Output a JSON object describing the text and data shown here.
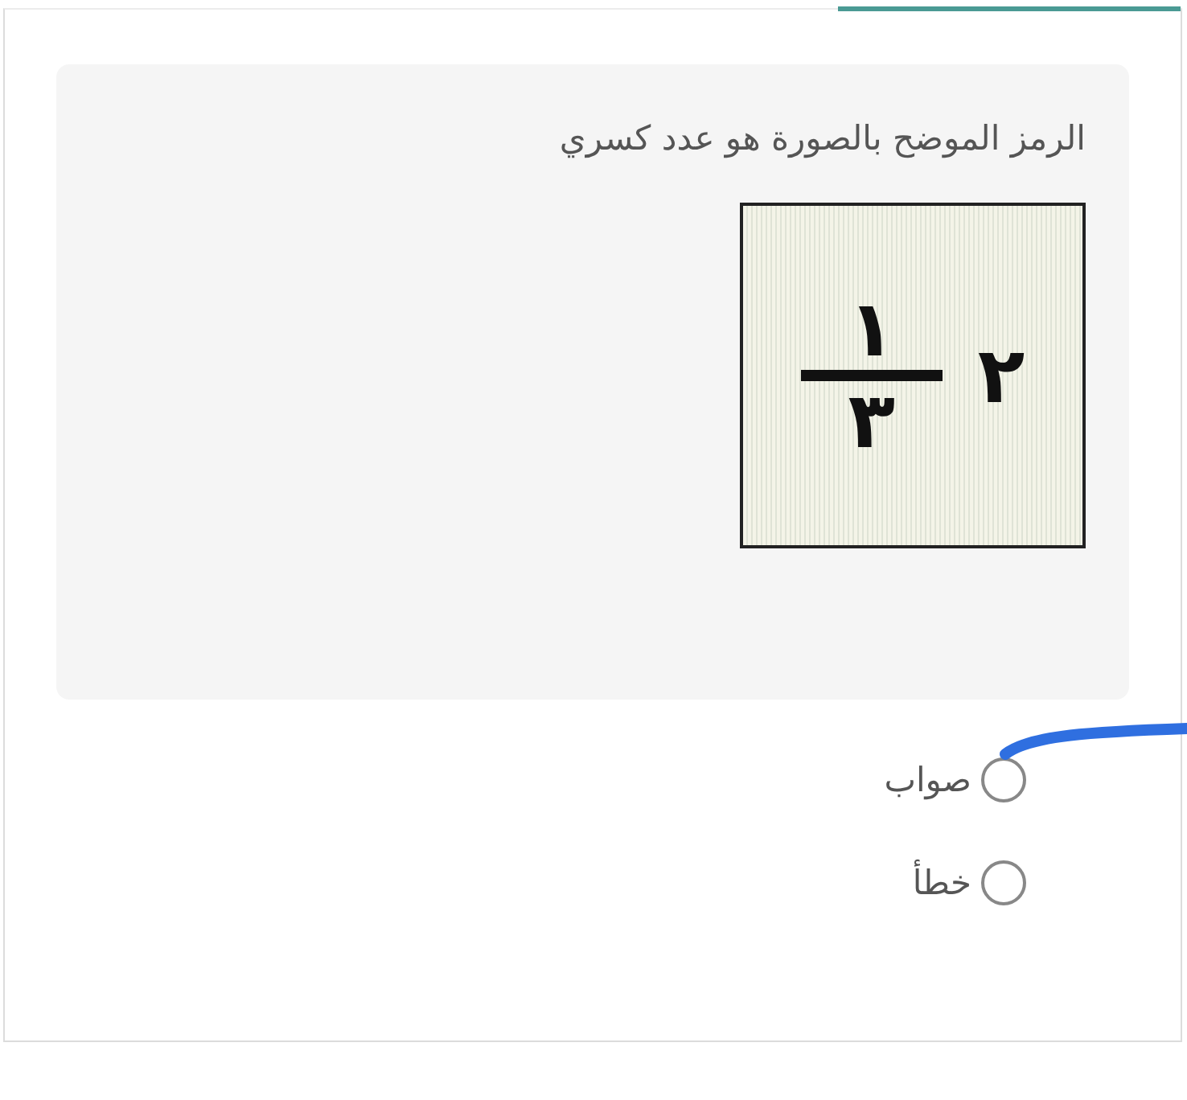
{
  "tabs": [
    {
      "selected": true
    }
  ],
  "question": {
    "text": "الرمز الموضح بالصورة هو عدد كسري",
    "image": {
      "whole": "٢",
      "numerator": "١",
      "denominator": "٣"
    }
  },
  "options": [
    {
      "label": "صواب",
      "selected": false
    },
    {
      "label": "خطأ",
      "selected": false
    }
  ],
  "annotation": {
    "kind": "pen-stroke"
  }
}
